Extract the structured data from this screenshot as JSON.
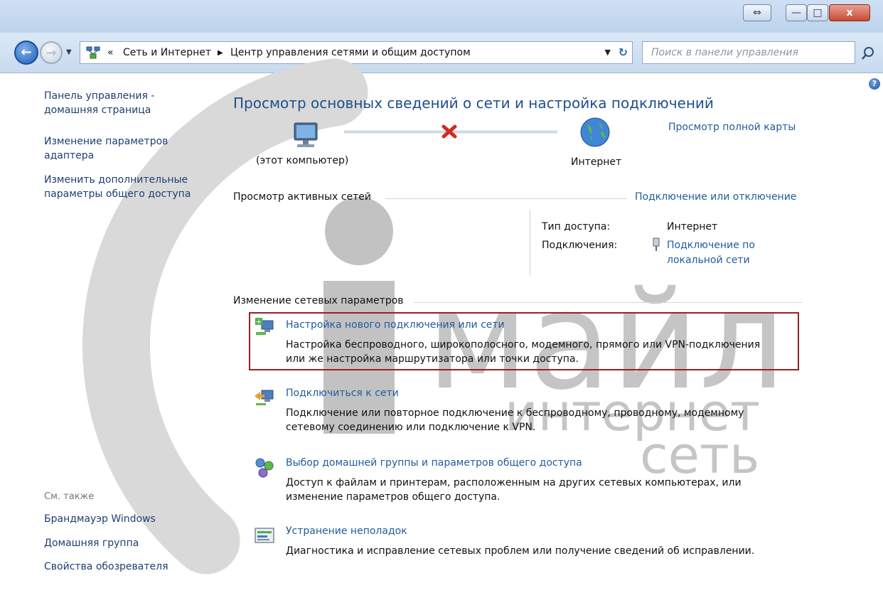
{
  "window": {
    "controls": {
      "restore_label": "⇔",
      "minimize_label": "—",
      "maximize_label": "□",
      "close_label": "x"
    }
  },
  "address_bar": {
    "overflow_label": "«",
    "crumbs": [
      "Сеть и Интернет",
      "Центр управления сетями и общим доступом"
    ],
    "separator": "▶",
    "search_placeholder": "Поиск в панели управления"
  },
  "sidebar": {
    "links": [
      "Панель управления - домашняя страница",
      "Изменение параметров адаптера",
      "Изменить дополнительные параметры общего доступа"
    ],
    "see_also_label": "См. также",
    "see_also": [
      "Брандмауэр Windows",
      "Домашняя группа",
      "Свойства обозревателя"
    ]
  },
  "main": {
    "title": "Просмотр основных сведений о сети и настройка подключений",
    "map": {
      "computer_label": "(этот компьютер)",
      "internet_label": "Интернет",
      "full_map_link": "Просмотр полной карты"
    },
    "active_networks": {
      "heading": "Просмотр активных сетей",
      "connect_link": "Подключение или отключение",
      "access_type_label": "Тип доступа:",
      "access_type_value": "Интернет",
      "connections_label": "Подключения:",
      "connection_link_line1": "Подключение по",
      "connection_link_line2": "локальной сети"
    },
    "change_settings": {
      "heading": "Изменение сетевых параметров",
      "tasks": [
        {
          "title": "Настройка нового подключения или сети",
          "desc_line1": "Настройка беспроводного, широкополосного, модемного, прямого или VPN-подключения",
          "desc_line2": "или же настройка маршрутизатора или точки доступа."
        },
        {
          "title": "Подключиться к сети",
          "desc_line1": "Подключение или повторное подключение к беспроводному, проводному, модемному",
          "desc_line2": "сетевому соединению или подключение к VPN."
        },
        {
          "title": "Выбор домашней группы и параметров общего доступа",
          "desc_line1": "Доступ к файлам и принтерам, расположенным на других сетевых компьютерах, или",
          "desc_line2": "изменение параметров общего доступа."
        },
        {
          "title": "Устранение неполадок",
          "desc_line1": "Диагностика и исправление сетевых проблем или получение сведений об исправлении."
        }
      ]
    }
  },
  "watermark": {
    "line1": "майл",
    "line2": "интернет",
    "line3": "сеть"
  },
  "colors": {
    "link": "#1f5c9e",
    "title": "#1e4f8c",
    "highlight_border": "#9a1f22",
    "error_x": "#d42b1e"
  }
}
